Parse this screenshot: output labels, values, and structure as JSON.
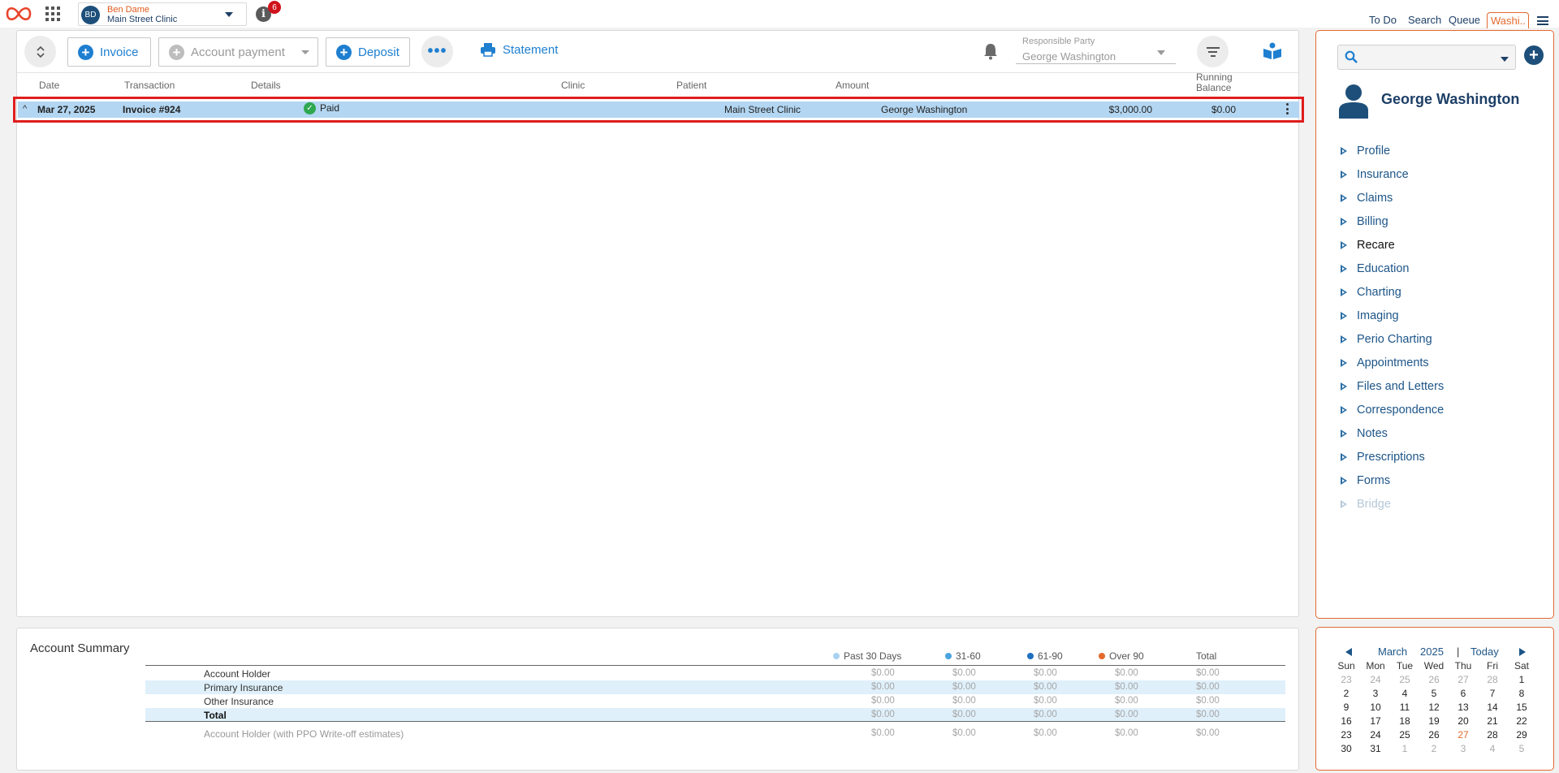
{
  "topbar": {
    "user": {
      "initials": "BD",
      "name": "Ben Dame",
      "clinic": "Main Street Clinic"
    },
    "notification_count": "6",
    "links": {
      "todo": "To Do",
      "search": "Search",
      "queue": "Queue"
    },
    "active_tab": "Washi.."
  },
  "toolbar": {
    "invoice_label": "Invoice",
    "account_payment_label": "Account payment",
    "deposit_label": "Deposit",
    "more_label": "•••",
    "statement_label": "Statement",
    "responsible_party_label": "Responsible Party",
    "responsible_party_value": "George Washington"
  },
  "table": {
    "headers": {
      "date": "Date",
      "transaction": "Transaction",
      "details": "Details",
      "clinic": "Clinic",
      "patient": "Patient",
      "amount": "Amount",
      "running_balance_1": "Running",
      "running_balance_2": "Balance"
    },
    "rows": [
      {
        "date": "Mar 27, 2025",
        "transaction": "Invoice #924",
        "details": "Paid",
        "clinic": "Main Street Clinic",
        "patient": "George Washington",
        "amount": "$3,000.00",
        "running_balance": "$0.00"
      }
    ]
  },
  "summary": {
    "title": "Account Summary",
    "columns": [
      "Past 30 Days",
      "31-60",
      "61-90",
      "Over 90",
      "Total"
    ],
    "column_colors": [
      "#a9d2f0",
      "#4aa3e0",
      "#1e6fc0",
      "#e36a2e"
    ],
    "rows": [
      {
        "label": "Account Holder",
        "values": [
          "$0.00",
          "$0.00",
          "$0.00",
          "$0.00",
          "$0.00"
        ]
      },
      {
        "label": "Primary Insurance",
        "values": [
          "$0.00",
          "$0.00",
          "$0.00",
          "$0.00",
          "$0.00"
        ]
      },
      {
        "label": "Other Insurance",
        "values": [
          "$0.00",
          "$0.00",
          "$0.00",
          "$0.00",
          "$0.00"
        ]
      },
      {
        "label": "Total",
        "values": [
          "$0.00",
          "$0.00",
          "$0.00",
          "$0.00",
          "$0.00"
        ]
      },
      {
        "label": "Account Holder (with PPO Write-off estimates)",
        "values": [
          "$0.00",
          "$0.00",
          "$0.00",
          "$0.00",
          "$0.00"
        ]
      }
    ]
  },
  "patient": {
    "name": "George Washington",
    "search_placeholder": "",
    "nav": [
      "Profile",
      "Insurance",
      "Claims",
      "Billing",
      "Recare",
      "Education",
      "Charting",
      "Imaging",
      "Perio Charting",
      "Appointments",
      "Files and Letters",
      "Correspondence",
      "Notes",
      "Prescriptions",
      "Forms",
      "Bridge"
    ]
  },
  "calendar": {
    "month": "March",
    "year": "2025",
    "separator": "|",
    "today_label": "Today",
    "days_of_week": [
      "Sun",
      "Mon",
      "Tue",
      "Wed",
      "Thu",
      "Fri",
      "Sat"
    ],
    "weeks": [
      [
        "23",
        "24",
        "25",
        "26",
        "27",
        "28",
        "1"
      ],
      [
        "2",
        "3",
        "4",
        "5",
        "6",
        "7",
        "8"
      ],
      [
        "9",
        "10",
        "11",
        "12",
        "13",
        "14",
        "15"
      ],
      [
        "16",
        "17",
        "18",
        "19",
        "20",
        "21",
        "22"
      ],
      [
        "23",
        "24",
        "25",
        "26",
        "27",
        "28",
        "29"
      ],
      [
        "30",
        "31",
        "1",
        "2",
        "3",
        "4",
        "5"
      ]
    ],
    "today": "27"
  },
  "colors": {
    "accent_orange": "#e36a2e",
    "link_blue": "#1e7fd0",
    "navy": "#1d3f66",
    "row_highlight": "#b3d6f2",
    "selection_border": "#e01d1d",
    "paid_green": "#2fa84f",
    "badge_red": "#d0121b"
  }
}
